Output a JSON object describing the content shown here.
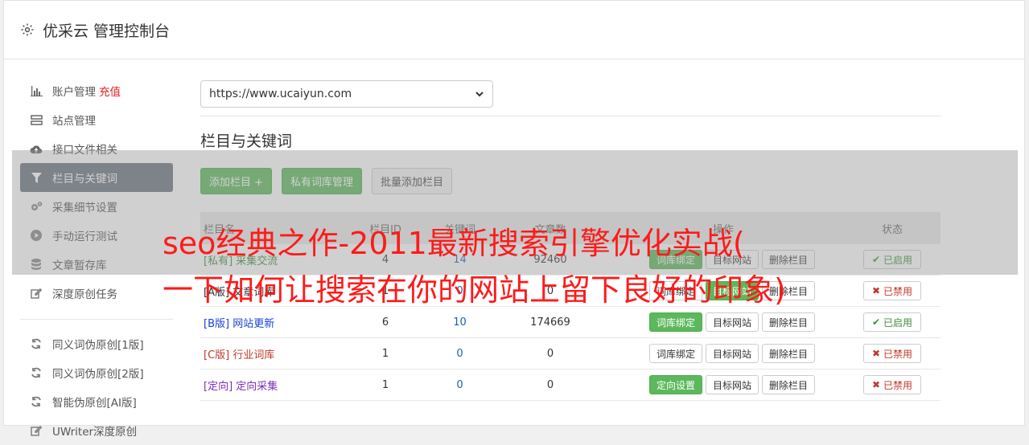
{
  "app": {
    "title": "优采云 管理控制台"
  },
  "sidebar": {
    "items": [
      {
        "label": "账户管理",
        "extra": "充值",
        "icon": "bar-chart-icon"
      },
      {
        "label": "站点管理",
        "icon": "server-icon"
      },
      {
        "label": "接口文件相关",
        "icon": "cloud-upload-icon"
      },
      {
        "label": "栏目与关键词",
        "icon": "filter-icon"
      },
      {
        "label": "采集细节设置",
        "icon": "cogs-icon"
      },
      {
        "label": "手动运行测试",
        "icon": "play-circle-icon"
      },
      {
        "label": "文章暂存库",
        "icon": "database-icon"
      },
      {
        "label": "深度原创任务",
        "icon": "edit-icon"
      }
    ],
    "items2": [
      {
        "label": "同义词伪原创[1版]",
        "icon": "refresh-icon"
      },
      {
        "label": "同义词伪原创[2版]",
        "icon": "refresh-icon"
      },
      {
        "label": "智能伪原创[AI版]",
        "icon": "refresh-icon"
      },
      {
        "label": "UWriter深度原创",
        "icon": "edit-icon"
      }
    ]
  },
  "main": {
    "site_select": "https://www.ucaiyun.com",
    "section_title": "栏目与关键词",
    "buttons": {
      "add": "添加栏目 +",
      "private": "私有词库管理",
      "batch": "批量添加栏目"
    },
    "table": {
      "headers": [
        "栏目名",
        "栏目ID",
        "关键词",
        "文章数",
        "操作",
        "状态"
      ],
      "rows": [
        {
          "tag": "[私有]",
          "name": "采集交流",
          "id": "4",
          "kw": "14",
          "count": "92460",
          "b1": "词库绑定",
          "b2": "目标网站",
          "b3": "删除栏目",
          "status": "已启用"
        },
        {
          "tag": "[A版]",
          "name": "文章词库",
          "id": "1",
          "kw": "0",
          "count": "0",
          "b1": "词库绑定",
          "b2": "目标网站",
          "b3": "删除栏目",
          "status": "已禁用"
        },
        {
          "tag": "[B版]",
          "name": "网站更新",
          "id": "6",
          "kw": "10",
          "count": "174669",
          "b1": "词库绑定",
          "b2": "目标网站",
          "b3": "删除栏目",
          "status": "已启用"
        },
        {
          "tag": "[C版]",
          "name": "行业词库",
          "id": "1",
          "kw": "0",
          "count": "0",
          "b1": "词库绑定",
          "b2": "目标网站",
          "b3": "删除栏目",
          "status": "已禁用"
        },
        {
          "tag": "[定向]",
          "name": "定向采集",
          "id": "1",
          "kw": "0",
          "count": "0",
          "b1": "定向设置",
          "b2": "目标网站",
          "b3": "删除栏目",
          "status": "已禁用"
        }
      ]
    }
  },
  "watermark": {
    "line1": "seo经典之作-2011最新搜索引擎优化实战(",
    "line2": "一下如何让搜索在你的网站上留下良好的印象)"
  },
  "colors": {
    "green": "#5cb85c",
    "active_side": "#6b7380",
    "watermark": "#ff1a1a"
  }
}
